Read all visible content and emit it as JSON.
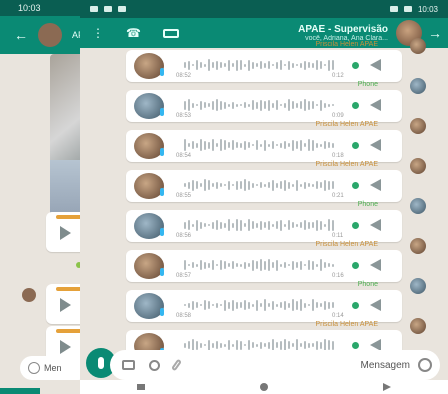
{
  "back_phone": {
    "status_time": "10:03",
    "header_title": "AF",
    "input_placeholder": "Men"
  },
  "status_bar": {
    "time": "10:03"
  },
  "header": {
    "title": "APAE - Supervisão",
    "subtitle": "você, Adriana, Ana Clara..."
  },
  "messages": [
    {
      "sender": "Priscila Helen APAE",
      "time": "08:52",
      "duration": "0:12"
    },
    {
      "sender": "Phone",
      "time": "08:53",
      "duration": "0:09"
    },
    {
      "sender": "Priscila Helen APAE",
      "time": "08:54",
      "duration": "0:18"
    },
    {
      "sender": "Priscila Helen APAE",
      "time": "08:55",
      "duration": "0:21"
    },
    {
      "sender": "Phone",
      "time": "08:56",
      "duration": "0:11"
    },
    {
      "sender": "Priscila Helen APAE",
      "time": "08:57",
      "duration": "0:16"
    },
    {
      "sender": "Phone",
      "time": "08:58",
      "duration": "0:14"
    },
    {
      "sender": "Priscila Helen APAE",
      "time": "08:59",
      "duration": "0:08"
    }
  ],
  "input": {
    "placeholder": "Mensagem"
  },
  "colors": {
    "header": "#0a8a74",
    "status": "#0a5e52",
    "chat_bg": "#e9e4dd",
    "accent_green": "#2aa76b"
  }
}
